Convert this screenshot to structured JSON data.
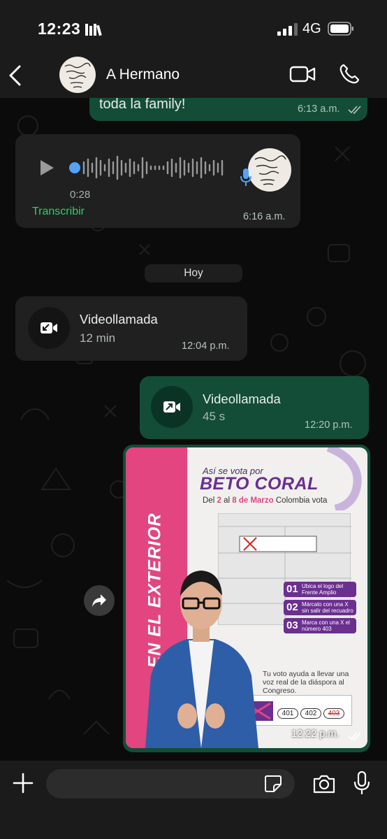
{
  "status_bar": {
    "time": "12:23",
    "network": "4G"
  },
  "header": {
    "contact_name": "A Hermano"
  },
  "messages": {
    "msg1": {
      "text": "toda la family!",
      "time": "6:13 a.m."
    },
    "voice": {
      "duration": "0:28",
      "transcribe_label": "Transcribir",
      "time": "6:16 a.m."
    },
    "day_separator": "Hoy",
    "call_in": {
      "title": "Videollamada",
      "duration": "12 min",
      "time": "12:04 p.m."
    },
    "call_out": {
      "title": "Videollamada",
      "duration": "45 s",
      "time": "12:20 p.m."
    },
    "image": {
      "time": "12:22 p.m.",
      "poster": {
        "side_text": "EN EL EXTERIOR",
        "kicker": "Así se vota por",
        "title": "BETO CORAL",
        "sub_prefix": "Del",
        "sub_day1": "2",
        "sub_mid": "al",
        "sub_day2": "8 de Marzo",
        "sub_suffix": "Colombia vota",
        "steps": [
          {
            "num": "01",
            "text": "Ubica el logo del Frente Amplio"
          },
          {
            "num": "02",
            "text": "Márcalo con una X sin salir del recuadro"
          },
          {
            "num": "03",
            "text": "Marca con una X el número 403"
          }
        ],
        "footer": "Tu voto ayuda a llevar una voz real de la diáspora al Congreso.",
        "numbers": [
          "401",
          "402",
          "403"
        ]
      }
    }
  },
  "input": {
    "placeholder": ""
  },
  "colors": {
    "outgoing_bubble": "#134d37",
    "incoming_bubble": "#202020",
    "accent_green": "#25d366",
    "read_ticks": "#b7c2bd"
  }
}
